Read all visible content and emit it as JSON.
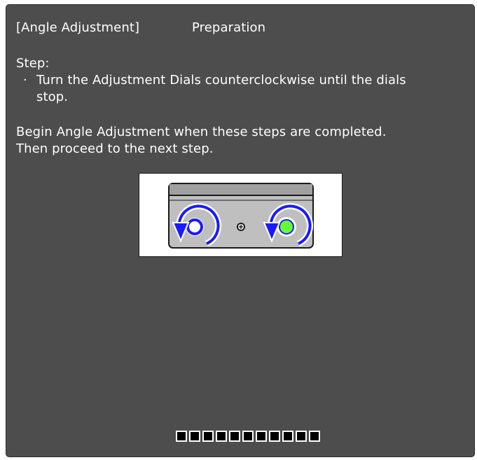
{
  "header": {
    "title": "[Angle Adjustment]",
    "subtitle": "Preparation"
  },
  "instructions": {
    "step_heading": "Step:",
    "bullet_symbol": "·",
    "bullet_line1": "Turn the Adjustment Dials counterclockwise until the dials",
    "bullet_line2": "stop.",
    "note_line1": "Begin Angle Adjustment when these steps are completed.",
    "note_line2": "Then proceed to the next step."
  },
  "illustration": {
    "description_icons": [
      "left-dial-icon",
      "right-dial-icon",
      "center-screw-icon",
      "counterclockwise-arrow-icon"
    ],
    "colors": {
      "arrow": "#1a1aff",
      "left_dial_ring": "#1a1aff",
      "right_dial_ring": "#1a1aff",
      "right_dial_fill": "#66ff33",
      "plate": "#bfbfbf",
      "plate_top": "#999999"
    }
  },
  "progress": {
    "total_steps": 11,
    "completed_steps": 0
  },
  "colors": {
    "panel_bg": "#4d4d4d",
    "text": "#ffffff"
  }
}
